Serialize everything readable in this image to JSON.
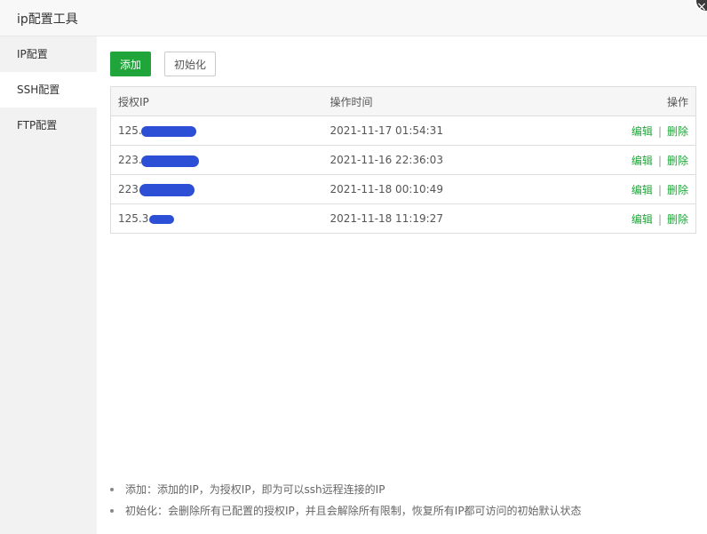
{
  "window": {
    "title": "ip配置工具",
    "close_glyph": "×"
  },
  "sidebar": {
    "items": [
      {
        "label": "IP配置"
      },
      {
        "label": "SSH配置"
      },
      {
        "label": "FTP配置"
      }
    ]
  },
  "toolbar": {
    "add_label": "添加",
    "init_label": "初始化"
  },
  "table": {
    "columns": [
      "授权IP",
      "操作时间",
      "操作"
    ],
    "rows": [
      {
        "ip": "125.",
        "time": "2021-11-17 01:54:31",
        "edit": "编辑",
        "sep": "|",
        "delete": "删除"
      },
      {
        "ip": "223.",
        "time": "2021-11-16 22:36:03",
        "edit": "编辑",
        "sep": "|",
        "delete": "删除"
      },
      {
        "ip": "223",
        "time": "2021-11-18 00:10:49",
        "edit": "编辑",
        "sep": "|",
        "delete": "删除"
      },
      {
        "ip": "125.3.",
        "time": "2021-11-18 11:19:27",
        "edit": "编辑",
        "sep": "|",
        "delete": "删除"
      }
    ]
  },
  "notes": [
    "添加：添加的IP，为授权IP，即为可以ssh远程连接的IP",
    "初始化：会删除所有已配置的授权IP，并且会解除所有限制，恢复所有IP都可访问的初始默认状态"
  ],
  "colors": {
    "accent": "#20a53a",
    "redaction": "#2d4fd6",
    "sidebar_bg": "#f2f2f2"
  }
}
